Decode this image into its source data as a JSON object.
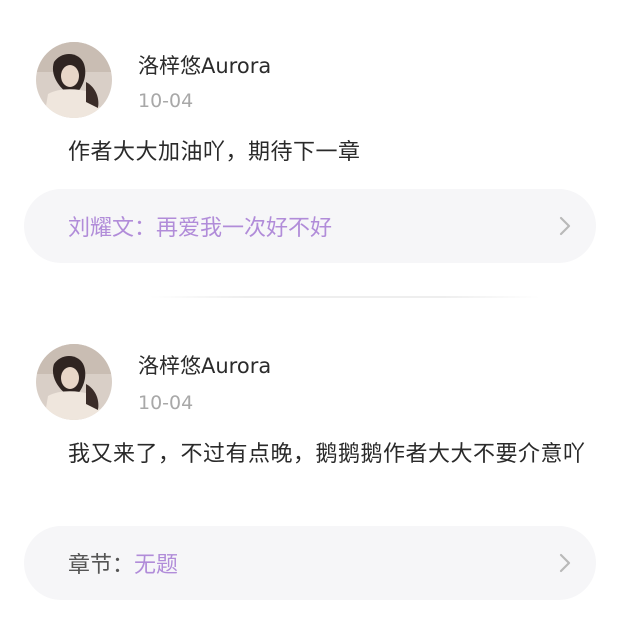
{
  "comments": [
    {
      "username": "洛梓悠Aurora",
      "date": "10-04",
      "content": "作者大大加油吖，期待下一章",
      "reference": {
        "prefix": "刘耀文：",
        "text": "再爱我一次好不好"
      }
    },
    {
      "username": "洛梓悠Aurora",
      "date": "10-04",
      "content": "我又来了，不过有点晚，鹅鹅鹅作者大大不要介意吖",
      "reference": {
        "prefix": "章节：",
        "text": "无题"
      }
    }
  ],
  "icons": {
    "avatar": "user-avatar-photo",
    "chevron": "chevron-right-icon"
  },
  "colors": {
    "accent": "#b18cd9",
    "date": "#a8a8a8",
    "ref_bg": "#f6f6f8"
  }
}
